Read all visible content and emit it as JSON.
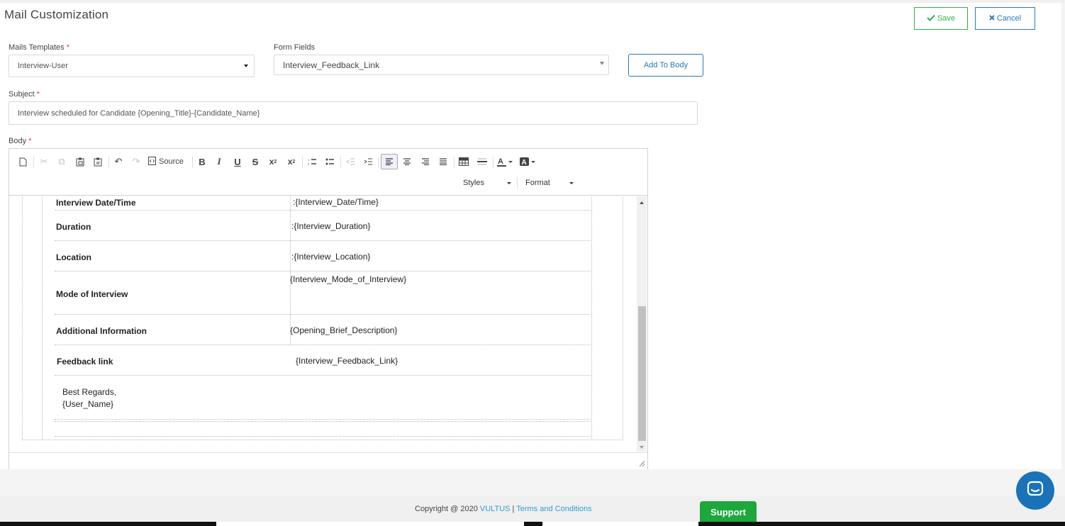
{
  "page": {
    "title": "Mail Customization",
    "save_label": "Save",
    "cancel_label": "Cancel",
    "required_mark": "*"
  },
  "form": {
    "templates_label": "Mails Templates",
    "templates_value": "Interview-User",
    "fields_label": "Form Fields",
    "fields_value": "Interview_Feedback_Link",
    "add_to_body_label": "Add To Body",
    "subject_label": "Subject",
    "subject_value": "Interview scheduled for Candidate {Opening_Title}-{Candidate_Name}",
    "body_label": "Body"
  },
  "editor": {
    "source_label": "Source",
    "styles_label": "Styles",
    "format_label": "Format",
    "rows": [
      {
        "key": "Interview Date/Time",
        "value": ":{Interview_Date/Time}"
      },
      {
        "key": "Duration",
        "value": ":{Interview_Duration}"
      },
      {
        "key": "Location",
        "value": ":{Interview_Location}"
      },
      {
        "key": "Mode of Interview",
        "value": "{Interview_Mode_of_Interview}"
      },
      {
        "key": "Additional Information",
        "value": "{Opening_Brief_Description}"
      },
      {
        "key": "Feedback link",
        "value": "{Interview_Feedback_Link}"
      }
    ],
    "signoff": "Best Regards,",
    "signature": "{User_Name}"
  },
  "footer": {
    "copyright": "Copyright @ 2020",
    "brand": "VULTUS",
    "separator": "|",
    "terms": "Terms and Conditions",
    "support": "Support"
  },
  "colors": {
    "save": "#2db34a",
    "primary": "#2b78b6",
    "support": "#1ea73c",
    "chat": "#1a72b8"
  }
}
